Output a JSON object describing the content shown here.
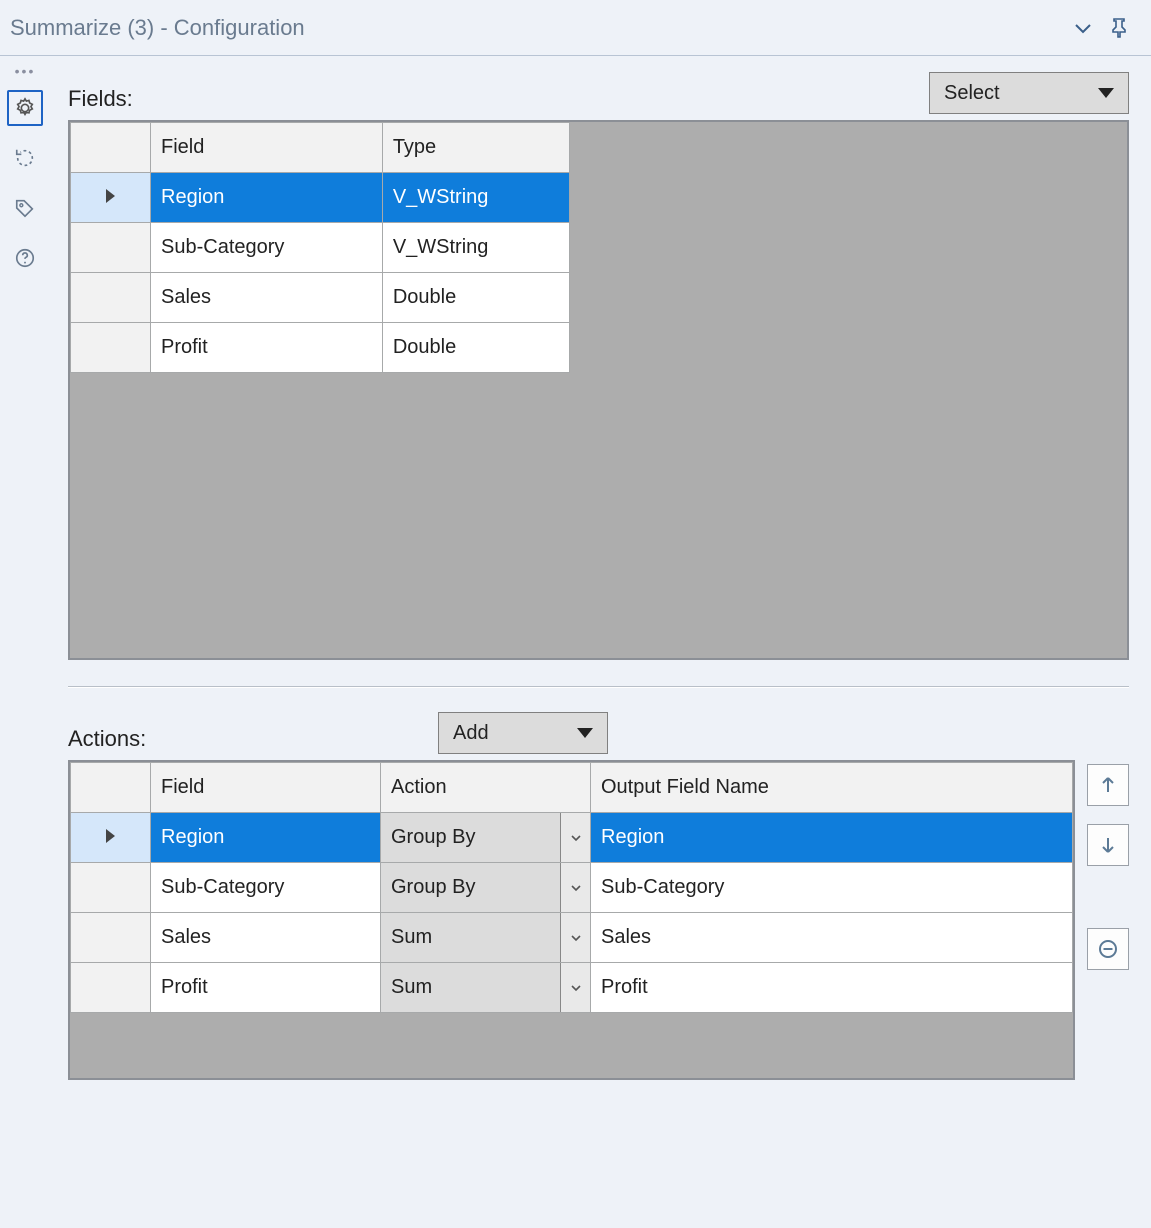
{
  "titlebar": {
    "title": "Summarize (3) - Configuration"
  },
  "fieldsSection": {
    "label": "Fields:",
    "selectButton": "Select",
    "headers": {
      "field": "Field",
      "type": "Type"
    },
    "rows": [
      {
        "field": "Region",
        "type": "V_WString",
        "selected": true
      },
      {
        "field": "Sub-Category",
        "type": "V_WString",
        "selected": false
      },
      {
        "field": "Sales",
        "type": "Double",
        "selected": false
      },
      {
        "field": "Profit",
        "type": "Double",
        "selected": false
      }
    ]
  },
  "actionsSection": {
    "label": "Actions:",
    "addButton": "Add",
    "headers": {
      "field": "Field",
      "action": "Action",
      "output": "Output Field Name"
    },
    "rows": [
      {
        "field": "Region",
        "action": "Group By",
        "output": "Region",
        "selected": true
      },
      {
        "field": "Sub-Category",
        "action": "Group By",
        "output": "Sub-Category",
        "selected": false
      },
      {
        "field": "Sales",
        "action": "Sum",
        "output": "Sales",
        "selected": false
      },
      {
        "field": "Profit",
        "action": "Sum",
        "output": "Profit",
        "selected": false
      }
    ]
  }
}
